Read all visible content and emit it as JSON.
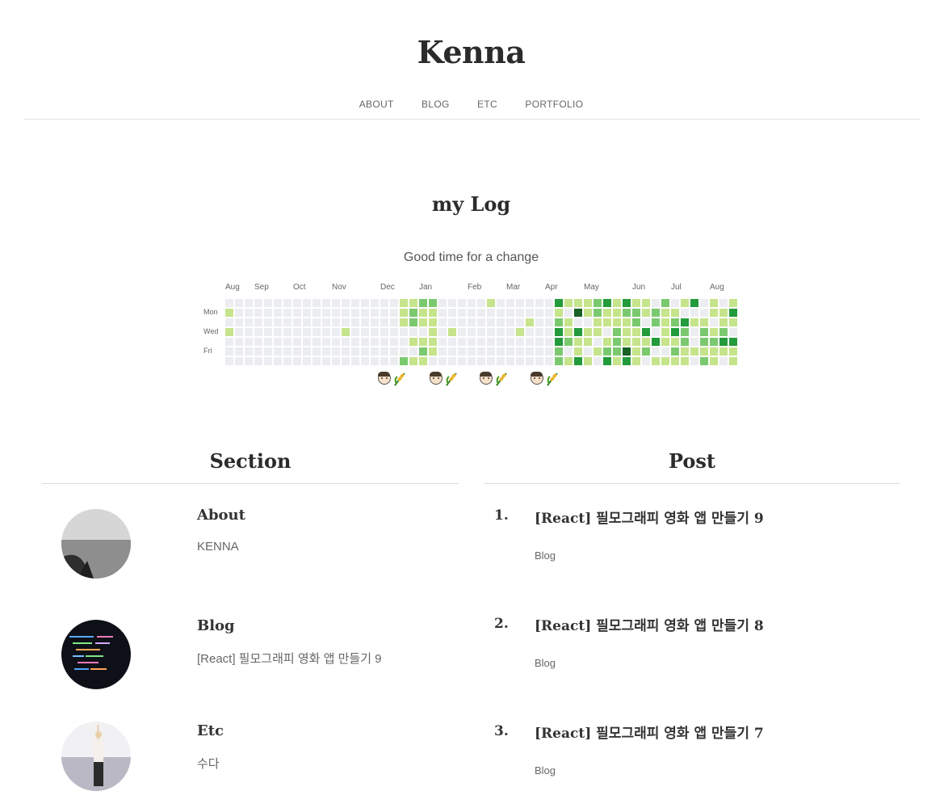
{
  "site": {
    "title": "Kenna"
  },
  "nav": {
    "items": [
      "ABOUT",
      "BLOG",
      "ETC",
      "PORTFOLIO"
    ]
  },
  "log": {
    "title": "my Log",
    "subtitle": "Good time for a change",
    "months": [
      "Aug",
      "Sep",
      "Oct",
      "Nov",
      "Dec",
      "Jan",
      "Feb",
      "Mar",
      "Apr",
      "May",
      "Jun",
      "Jul",
      "Aug"
    ],
    "days": [
      "Mon",
      "Wed",
      "Fri"
    ],
    "colors": [
      "#ebedf0",
      "#c6e48b",
      "#7bc96f",
      "#239a3b",
      "#196127"
    ]
  },
  "sections": {
    "title": "Section",
    "items": [
      {
        "title": "About",
        "desc": "KENNA"
      },
      {
        "title": "Blog",
        "desc": "[React] 필모그래피 영화 앱 만들기 9"
      },
      {
        "title": "Etc",
        "desc": "수다"
      }
    ]
  },
  "posts": {
    "title": "Post",
    "items": [
      {
        "num": "1.",
        "title": "[React] 필모그래피 영화 앱 만들기 9",
        "category": "Blog"
      },
      {
        "num": "2.",
        "title": "[React] 필모그래피 영화 앱 만들기 8",
        "category": "Blog"
      },
      {
        "num": "3.",
        "title": "[React] 필모그래피 영화 앱 만들기 7",
        "category": "Blog"
      }
    ]
  }
}
